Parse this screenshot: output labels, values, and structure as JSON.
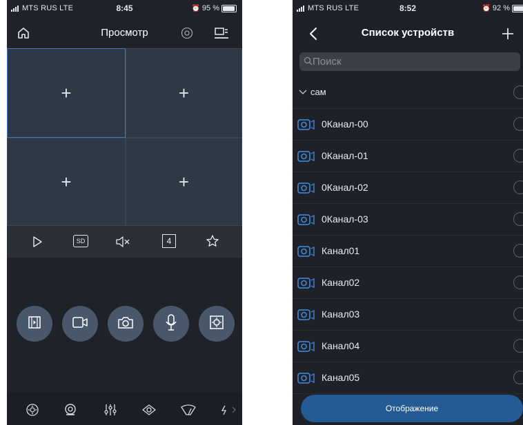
{
  "left_screen": {
    "status": {
      "carrier": "MTS RUS  LTE",
      "time": "8:45",
      "battery_text": "95 %",
      "battery_level": 0.95
    },
    "title": "Просмотр",
    "grid": {
      "cells": [
        "+",
        "+",
        "+",
        "+"
      ],
      "selected_index": 0
    },
    "toolbar": {
      "icons": [
        "play-icon",
        "sd-quality-icon",
        "mute-icon",
        "split-4-icon",
        "favorite-star-icon"
      ],
      "sd_label": "SD",
      "split_label": "4"
    },
    "actions": {
      "icons": [
        "playback-icon",
        "record-icon",
        "snapshot-icon",
        "microphone-icon",
        "ptz-icon"
      ]
    },
    "bottom_tabs": {
      "icons": [
        "ptz-direction-icon",
        "zoom-icon",
        "adjust-icon",
        "focus-icon",
        "wiper-icon",
        "more-icon"
      ]
    },
    "colors": {
      "background": "#1f2229",
      "cell": "#2f3945",
      "selected_border": "#3f7ac4",
      "action_button": "#48576a"
    }
  },
  "right_screen": {
    "status": {
      "carrier": "MTS RUS  LTE",
      "time": "8:52",
      "battery_text": "92 %",
      "battery_level": 0.92
    },
    "title": "Список устройств",
    "search": {
      "placeholder": "Поиск"
    },
    "group": {
      "name": "сам"
    },
    "devices": [
      "0Канал-00",
      "0Канал-01",
      "0Канал-02",
      "0Канал-03",
      "Канал01",
      "Канал02",
      "Канал03",
      "Канал04",
      "Канал05"
    ],
    "display_button": "Отображение",
    "colors": {
      "background": "#1e2128",
      "accent": "#245b94",
      "camera_icon": "#3d7fc8"
    }
  }
}
